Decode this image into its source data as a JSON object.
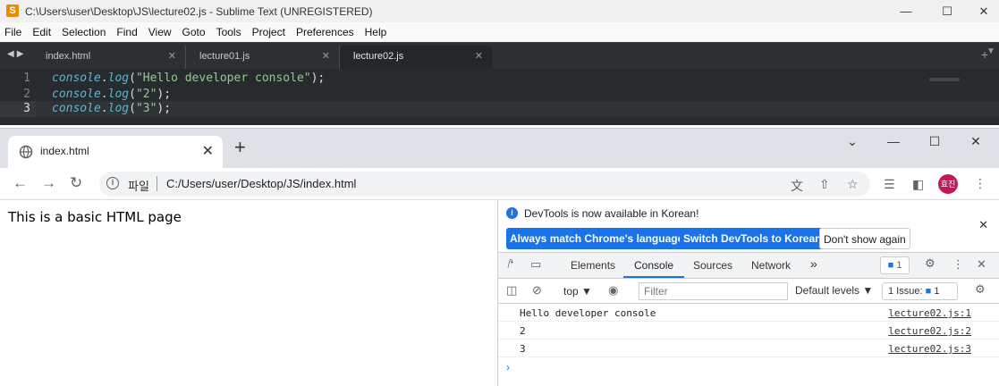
{
  "sublime": {
    "title": "C:\\Users\\user\\Desktop\\JS\\lecture02.js - Sublime Text (UNREGISTERED)",
    "menu": [
      "File",
      "Edit",
      "Selection",
      "Find",
      "View",
      "Goto",
      "Tools",
      "Project",
      "Preferences",
      "Help"
    ],
    "tabs": [
      {
        "label": "index.html",
        "active": false
      },
      {
        "label": "lecture01.js",
        "active": false
      },
      {
        "label": "lecture02.js",
        "active": true
      }
    ],
    "code_lines": [
      {
        "num": "1",
        "obj": "console",
        "dot": ".",
        "fn": "log",
        "open": "(",
        "str": "\"Hello developer console\"",
        "close": ");"
      },
      {
        "num": "2",
        "obj": "console",
        "dot": ".",
        "fn": "log",
        "open": "(",
        "str": "\"2\"",
        "close": ");"
      },
      {
        "num": "3",
        "obj": "console",
        "dot": ".",
        "fn": "log",
        "open": "(",
        "str": "\"3\"",
        "close": ");"
      }
    ]
  },
  "chrome": {
    "tab_title": "index.html",
    "new_tab": "+",
    "address_scheme": "파일",
    "address_url": "C:/Users/user/Desktop/JS/index.html",
    "avatar_text": "효진",
    "page_text": "This is a basic HTML page"
  },
  "devtools": {
    "info_text": "DevTools is now available in Korean!",
    "btn_match": "Always match Chrome's language",
    "btn_switch": "Switch DevTools to Korean",
    "btn_dont": "Don't show again",
    "tabs": [
      "Elements",
      "Console",
      "Sources",
      "Network"
    ],
    "more_tabs": "»",
    "issues_count": "1",
    "context": "top",
    "filter_placeholder": "Filter",
    "levels": "Default levels",
    "issues_label": "1 Issue:",
    "issues_label_count": "1",
    "console": [
      {
        "msg": "Hello developer console",
        "src": "lecture02.js:1"
      },
      {
        "msg": "2",
        "src": "lecture02.js:2"
      },
      {
        "msg": "3",
        "src": "lecture02.js:3"
      }
    ],
    "prompt": "›"
  },
  "colors": {
    "accent": "#1a73e8",
    "sublime_bg": "#272b2e",
    "chrome_strip": "#dee1e6"
  }
}
